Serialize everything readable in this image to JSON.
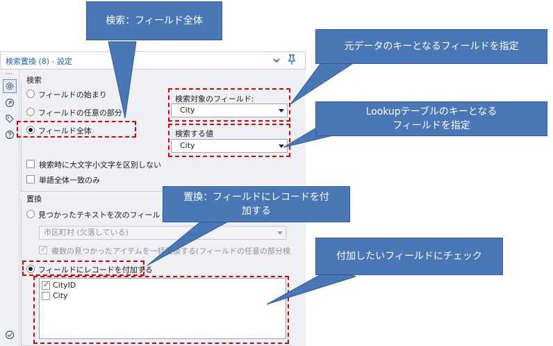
{
  "window": {
    "title": "検索置換 (8) - 設定",
    "dots": "⋯"
  },
  "search": {
    "group_label": "検索",
    "radio_start": "フィールドの始まり",
    "radio_any": "フィールドの任意の部分",
    "radio_entire": "フィールド全体",
    "selected": "entire",
    "target_field_label": "検索対象のフィールド:",
    "target_field_value": "City",
    "search_value_label": "検索する値",
    "search_value_value": "City",
    "case_sensitive_label": "検索時に大文字小文字を区別しない",
    "whole_word_label": "単語全体一致のみ"
  },
  "replace": {
    "group_label": "置換",
    "radio_replace_text": "見つかったテキストを次のフィールドの値",
    "replace_field_value": "市区町村 (欠落している)",
    "multiple_label": "複数の見つかったアイテムを一括置換する(フィールドの任意の部分検",
    "radio_append": "フィールドにレコードを付加する",
    "fields": [
      {
        "name": "CityID",
        "checked": true
      },
      {
        "name": "City",
        "checked": false
      }
    ]
  },
  "callouts": {
    "search_entire": "検索：フィールド全体",
    "key_field": "元データのキーとなるフィールドを指定",
    "lookup_line1": "Lookupテーブルのキーとなる",
    "lookup_line2": "フィールドを指定",
    "replace_line1": "置換：フィールドにレコードを付",
    "replace_line2": "加する",
    "check_fields": "付加したいフィールドにチェック"
  },
  "colors": {
    "callout_fill": "#4a78b6",
    "annotation_red": "#e00000",
    "title_blue": "#1f5fa8"
  }
}
